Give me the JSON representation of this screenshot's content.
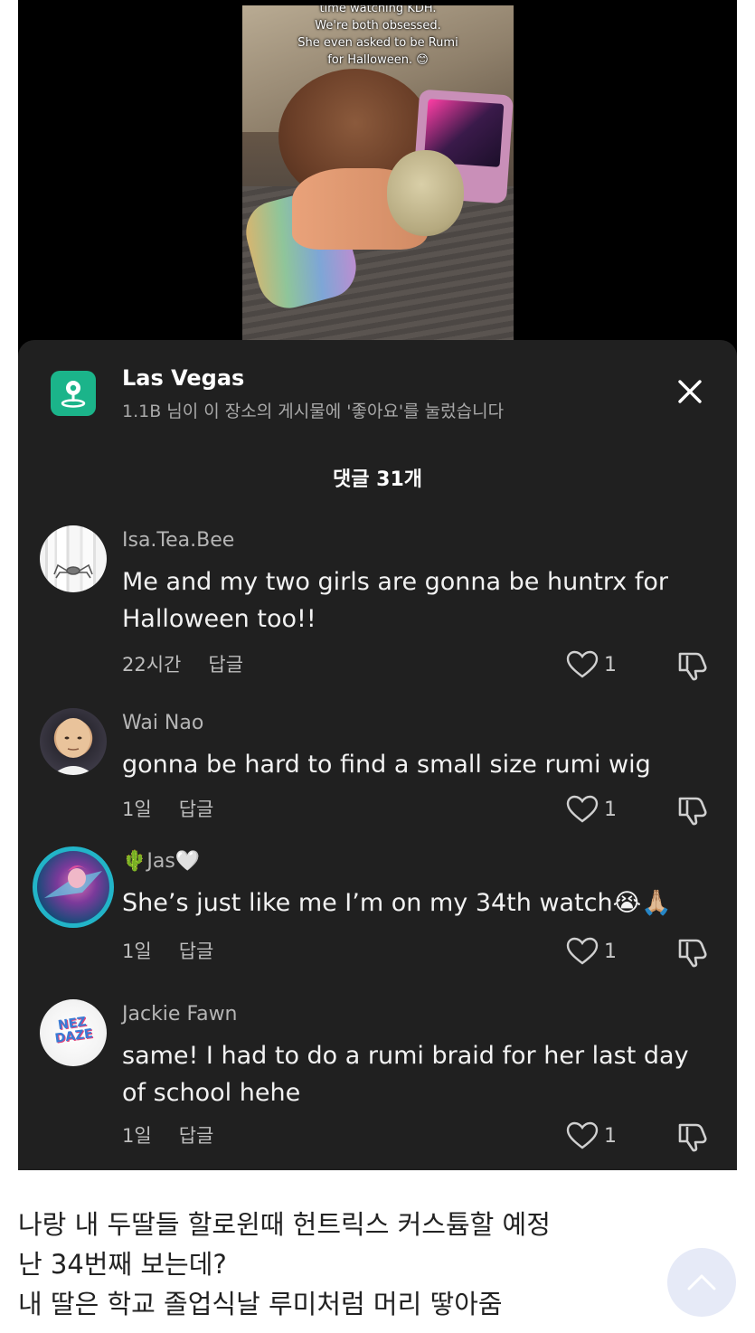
{
  "video": {
    "caption_lines": [
      "time watching KDH.",
      "We're both obsessed.",
      "She even asked to be Rumi",
      "for Halloween. 😊"
    ]
  },
  "place": {
    "name": "Las Vegas",
    "subtitle": "1.1B 님이 이 장소의 게시물에 '좋아요'를 눌렀습니다",
    "icon": "map-pin-icon"
  },
  "comments_header": "댓글 31개",
  "comments": [
    {
      "author": "Isa.Tea.Bee",
      "text": "Me and my two girls are gonna be huntrx for Halloween too!!",
      "time": "22시간",
      "reply": "답글",
      "likes": "1"
    },
    {
      "author": "Wai Nao",
      "text": "gonna be hard to find a small size rumi wig",
      "time": "1일",
      "reply": "답글",
      "likes": "1"
    },
    {
      "author": "🌵Jas🤍",
      "text": "She’s just like me I’m on my 34th watch😭🙏🏼",
      "time": "1일",
      "reply": "답글",
      "likes": "1"
    },
    {
      "author": "Jackie Fawn",
      "text": "same! I had to do a rumi braid for her last day of school hehe",
      "time": "1일",
      "reply": "답글",
      "likes": "1"
    }
  ],
  "post_text": [
    "나랑 내 두딸들 할로윈때 헌트릭스 커스튬할 예정",
    "난 34번째 보는데?",
    "내 딸은 학교 졸업식날 루미처럼 머리 땋아줌"
  ],
  "avatar4_logo": "NEZ\nDAZE",
  "colors": {
    "sheet_bg": "#202020",
    "place_icon": "#1bb48a",
    "jas_ring": "#22b4c8"
  }
}
